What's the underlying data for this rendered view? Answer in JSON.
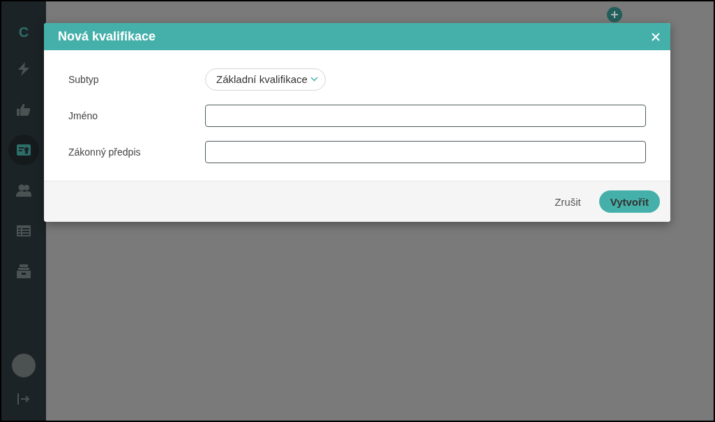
{
  "sidebar": {
    "logo": "C",
    "items": [
      {
        "selected": false
      },
      {
        "selected": false
      },
      {
        "selected": true
      },
      {
        "selected": false
      },
      {
        "selected": false
      },
      {
        "selected": false
      }
    ]
  },
  "dialog": {
    "title": "Nová kvalifikace",
    "fields": [
      {
        "label": "Subtyp",
        "kind": "select",
        "value": "Základní kvalifikace"
      },
      {
        "label": "Jméno",
        "kind": "text"
      },
      {
        "label": "Zákonný předpis",
        "kind": "text"
      }
    ],
    "buttons": [
      {
        "label": "Zrušit",
        "kind": "flat"
      },
      {
        "label": "Vytvořit",
        "kind": "primary"
      }
    ]
  }
}
